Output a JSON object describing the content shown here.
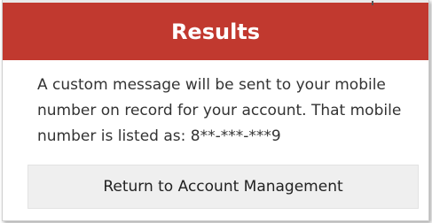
{
  "header": {
    "title": "Results",
    "color": "#c1392f"
  },
  "body": {
    "message": "A custom message will be sent to your mobile number on record for your account. That mobile number is listed as: 8**-***-***9"
  },
  "actions": {
    "return_label": "Return to Account Management"
  }
}
